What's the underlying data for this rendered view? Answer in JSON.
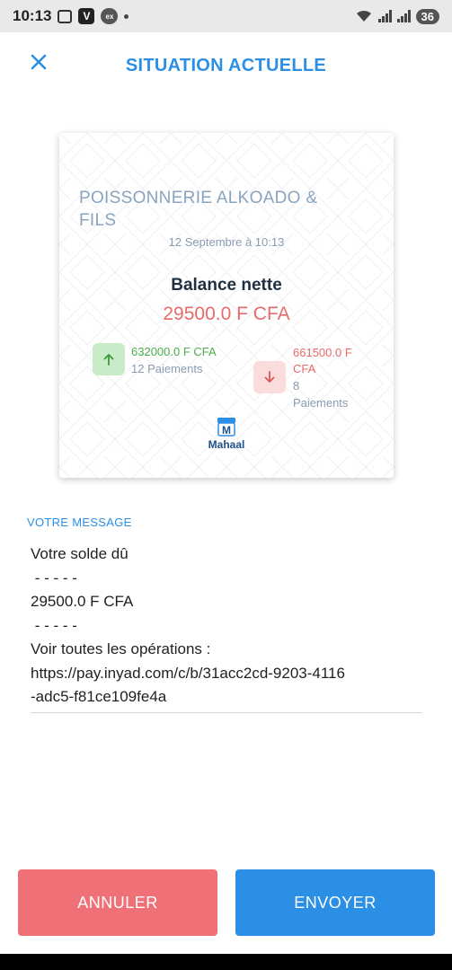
{
  "status_bar": {
    "time": "10:13",
    "app_icon_v": "V",
    "app_icon_ex": "ex",
    "battery": "36"
  },
  "header": {
    "title": "SITUATION ACTUELLE",
    "close_icon": "close-icon"
  },
  "card": {
    "shop_name": "POISSONNERIE ALKOADO & FILS",
    "date": "12 Septembre à 10:13",
    "balance_label": "Balance nette",
    "balance_value": "29500.0 F CFA",
    "incoming": {
      "amount": "632000.0 F CFA",
      "count": "12 Paiements",
      "color": "#4cae4c"
    },
    "outgoing": {
      "amount": "661500.0 F CFA",
      "count": "8 Paiements",
      "color": "#e86a6a"
    },
    "logo_text": "Mahaal",
    "logo_letter": "M"
  },
  "message": {
    "label": "VOTRE MESSAGE",
    "lines": [
      "Votre solde dû",
      " - - - - -",
      "29500.0 F CFA",
      " - - - - -",
      "Voir toutes les opérations :",
      "https://pay.inyad.com/c/b/31acc2cd-9203-4116",
      "-adc5-f81ce109fe4a"
    ]
  },
  "actions": {
    "cancel_label": "ANNULER",
    "send_label": "ENVOYER",
    "cancel_color": "#f07077",
    "send_color": "#2b8fe6"
  }
}
